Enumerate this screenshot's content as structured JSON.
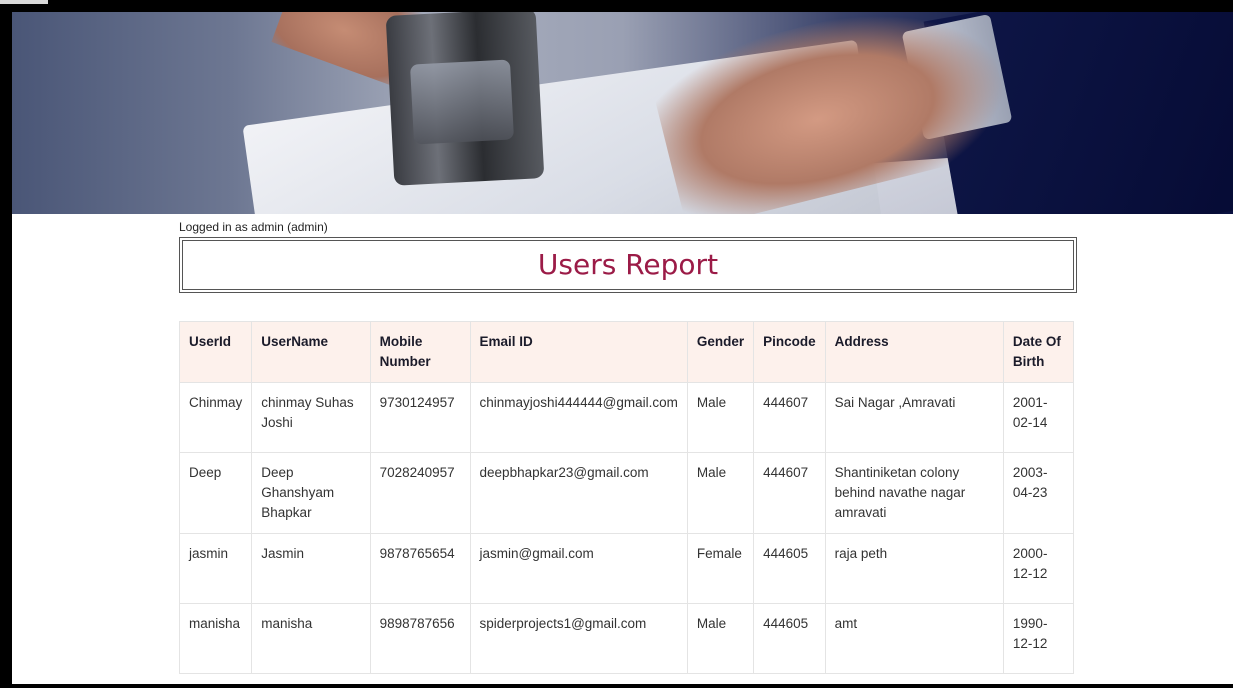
{
  "session": {
    "logged_in_text": "Logged in as admin (admin)"
  },
  "page": {
    "title": "Users Report"
  },
  "table": {
    "headers": {
      "userid": "UserId",
      "username": "UserName",
      "mobile": "Mobile Number",
      "email": "Email ID",
      "gender": "Gender",
      "pincode": "Pincode",
      "address": "Address",
      "dob": "Date Of Birth"
    },
    "rows": [
      {
        "userid": "Chinmay",
        "username": "chinmay Suhas Joshi",
        "mobile": "9730124957",
        "email": "chinmayjoshi444444@gmail.com",
        "gender": "Male",
        "pincode": "444607",
        "address": "Sai Nagar ,Amravati",
        "dob": "2001-02-14"
      },
      {
        "userid": "Deep",
        "username": "Deep Ghanshyam Bhapkar",
        "mobile": "7028240957",
        "email": "deepbhapkar23@gmail.com",
        "gender": "Male",
        "pincode": "444607",
        "address": "Shantiniketan colony behind navathe nagar amravati",
        "dob": "2003-04-23"
      },
      {
        "userid": "jasmin",
        "username": "Jasmin",
        "mobile": "9878765654",
        "email": "jasmin@gmail.com",
        "gender": "Female",
        "pincode": "444605",
        "address": "raja peth",
        "dob": "2000-12-12"
      },
      {
        "userid": "manisha",
        "username": "manisha",
        "mobile": "9898787656",
        "email": "spiderprojects1@gmail.com",
        "gender": "Male",
        "pincode": "444605",
        "address": "amt",
        "dob": "1990-12-12"
      }
    ]
  },
  "colors": {
    "title": "#9b1b47",
    "header_bg": "#fdf1ec",
    "banner_dark": "#0a1140"
  }
}
